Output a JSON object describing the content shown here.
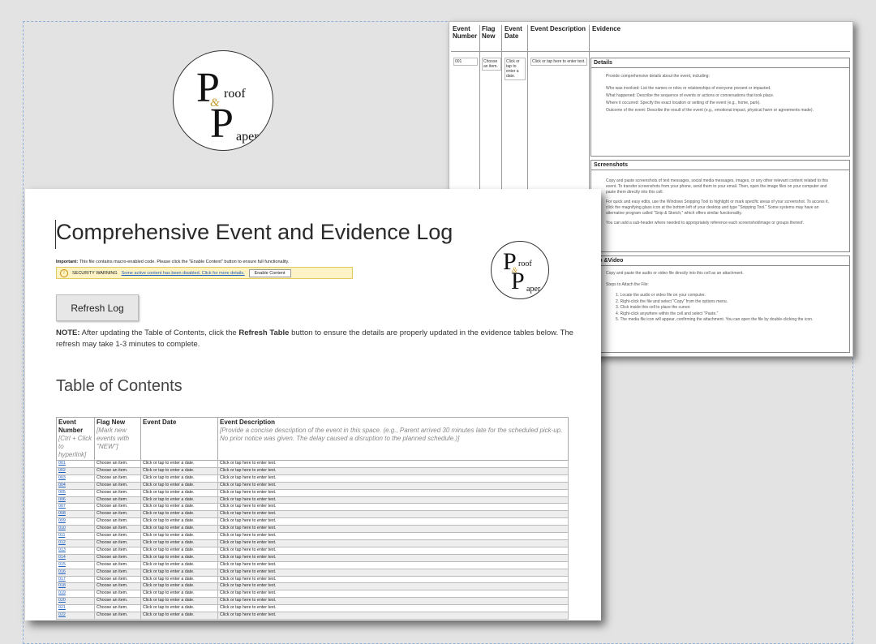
{
  "logo": {
    "p1": "P",
    "w1": "roof",
    "amp": "&",
    "p2": "P",
    "w2": "aper"
  },
  "back_doc": {
    "headers": [
      "Event Number",
      "Flag New",
      "Event Date",
      "Event Description",
      "Evidence"
    ],
    "first_row": {
      "num": "001",
      "flag": "Choose an item.",
      "date": "Click or tap to enter a date.",
      "desc": "Click or tap here to enter text."
    },
    "details": {
      "title": "Details",
      "intro": "Provide comprehensive details about the event, including:",
      "items": [
        "Who was involved: List the names or roles or relationships of everyone present or impacted.",
        "What happened: Describe the sequence of events or actions or conversations that took place.",
        "Where it occurred: Specify the exact location or setting of the event (e.g., home, park).",
        "Outcome of the event: Describe the result of the event (e.g., emotional impact, physical harm or agreements made)."
      ]
    },
    "screenshots": {
      "title": "Screenshots",
      "paras": [
        "Copy and paste screenshots of text messages, social media messages, images, or any other relevant content related to this event. To transfer screenshots from your phone, send them to your email. Then, open the image files on your computer and paste them directly into this cell.",
        "For quick and easy edits, use the Windows Snipping Tool to highlight or mark specific areas of your screenshot. To access it, click the magnifying glass icon at the bottom left of your desktop and type \"Snipping Tool.\" Some systems may have an alternative program called \"Snip & Sketch,\" which offers similar functionality.",
        "You can add a sub-header where needed to appropriately reference each screenshot/image or groups thereof."
      ]
    },
    "audio": {
      "title": "dio &Video",
      "intro": "Copy and paste the audio or video file directly into this cell as an attachment.",
      "steps_title": "Steps to Attach the File:",
      "steps": [
        "1. Locate the audio or video file on your computer.",
        "2. Right-click the file and select \"Copy\" from the options menu.",
        "3. Click inside this cell to place the cursor.",
        "4. Right-click anywhere within the cell and select \"Paste.\"",
        "5. The media file icon will appear, confirming the attachment. You can open the file by double-clicking the icon."
      ]
    }
  },
  "front_doc": {
    "title": "Comprehensive Event and Evidence Log",
    "important_label": "Important:",
    "important_text": " This file contains macro-enabled code. Please click the \"Enable Content\" button to ensure full functionality.",
    "security_label": "SECURITY WARNING",
    "security_link": "Some active content has been disabled. Click for more details.",
    "enable_button": "Enable Content",
    "refresh_button": "Refresh Log",
    "note_label": "NOTE:",
    "note_text_1": " After updating the Table of Contents, click the ",
    "note_bold": "Refresh Table",
    "note_text_2": " button to ensure the details are properly updated in the evidence tables below. The refresh may take 1-3 minutes to complete.",
    "toc_title": "Table of Contents",
    "toc_headers": {
      "num": "Event Number",
      "num_sub": "[Ctrl + Click to hyperlink]",
      "flag": "Flag New",
      "flag_sub": "[Mark new events with \"NEW\"]",
      "date": "Event Date",
      "desc": "Event Description",
      "desc_sub": "[Provide a concise description of the event in this space. (e.g., Parent arrived 30 minutes late for the scheduled pick-up. No prior notice was given. The delay caused a disruption to the planned schedule.)]"
    },
    "toc_rows": [
      {
        "num": "001",
        "flag": "Choose an item.",
        "date": "Click or tap to enter a date.",
        "desc": "Click or tap here to enter text."
      },
      {
        "num": "002",
        "flag": "Choose an item.",
        "date": "Click or tap to enter a date.",
        "desc": "Click or tap here to enter text."
      },
      {
        "num": "003",
        "flag": "Choose an item.",
        "date": "Click or tap to enter a date.",
        "desc": "Click or tap here to enter text."
      },
      {
        "num": "004",
        "flag": "Choose an item.",
        "date": "Click or tap to enter a date.",
        "desc": "Click or tap here to enter text."
      },
      {
        "num": "005",
        "flag": "Choose an item.",
        "date": "Click or tap to enter a date.",
        "desc": "Click or tap here to enter text."
      },
      {
        "num": "006",
        "flag": "Choose an item.",
        "date": "Click or tap to enter a date.",
        "desc": "Click or tap here to enter text."
      },
      {
        "num": "007",
        "flag": "Choose an item.",
        "date": "Click or tap to enter a date.",
        "desc": "Click or tap here to enter text."
      },
      {
        "num": "008",
        "flag": "Choose an item.",
        "date": "Click or tap to enter a date.",
        "desc": "Click or tap here to enter text."
      },
      {
        "num": "009",
        "flag": "Choose an item.",
        "date": "Click or tap to enter a date.",
        "desc": "Click or tap here to enter text."
      },
      {
        "num": "010",
        "flag": "Choose an item.",
        "date": "Click or tap to enter a date.",
        "desc": "Click or tap here to enter text."
      },
      {
        "num": "011",
        "flag": "Choose an item.",
        "date": "Click or tap to enter a date.",
        "desc": "Click or tap here to enter text."
      },
      {
        "num": "012",
        "flag": "Choose an item.",
        "date": "Click or tap to enter a date.",
        "desc": "Click or tap here to enter text."
      },
      {
        "num": "013",
        "flag": "Choose an item.",
        "date": "Click or tap to enter a date.",
        "desc": "Click or tap here to enter text."
      },
      {
        "num": "014",
        "flag": "Choose an item.",
        "date": "Click or tap to enter a date.",
        "desc": "Click or tap here to enter text."
      },
      {
        "num": "015",
        "flag": "Choose an item.",
        "date": "Click or tap to enter a date.",
        "desc": "Click or tap here to enter text."
      },
      {
        "num": "016",
        "flag": "Choose an item.",
        "date": "Click or tap to enter a date.",
        "desc": "Click or tap here to enter text."
      },
      {
        "num": "017",
        "flag": "Choose an item.",
        "date": "Click or tap to enter a date.",
        "desc": "Click or tap here to enter text."
      },
      {
        "num": "018",
        "flag": "Choose an item.",
        "date": "Click or tap to enter a date.",
        "desc": "Click or tap here to enter text."
      },
      {
        "num": "019",
        "flag": "Choose an item.",
        "date": "Click or tap to enter a date.",
        "desc": "Click or tap here to enter text."
      },
      {
        "num": "020",
        "flag": "Choose an item.",
        "date": "Click or tap to enter a date.",
        "desc": "Click or tap here to enter text."
      },
      {
        "num": "021",
        "flag": "Choose an item.",
        "date": "Click or tap to enter a date.",
        "desc": "Click or tap here to enter text."
      },
      {
        "num": "022",
        "flag": "Choose an item.",
        "date": "Click or tap to enter a date.",
        "desc": "Click or tap here to enter text."
      }
    ]
  }
}
